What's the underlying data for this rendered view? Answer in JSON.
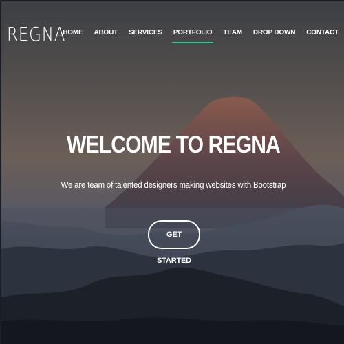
{
  "brand": {
    "logo_text": "REGNA"
  },
  "nav": {
    "items": [
      {
        "label": "HOME",
        "active": false
      },
      {
        "label": "ABOUT",
        "active": false
      },
      {
        "label": "SERVICES",
        "active": false
      },
      {
        "label": "PORTFOLIO",
        "active": true
      },
      {
        "label": "TEAM",
        "active": false
      },
      {
        "label": "DROP DOWN",
        "active": false
      },
      {
        "label": "CONTACT",
        "active": false
      }
    ]
  },
  "hero": {
    "title": "WELCOME TO REGNA",
    "subtitle": "We are team of talented designers making websites with Bootstrap",
    "cta_label": "GET STARTED",
    "background_image": "mountain-landscape-at-dusk"
  },
  "colors": {
    "accent": "#2dc997",
    "text": "#ffffff",
    "sky_top": "#3c3f45",
    "sky_glow": "#7a6a5c",
    "mountain_dark": "#1e222b"
  }
}
